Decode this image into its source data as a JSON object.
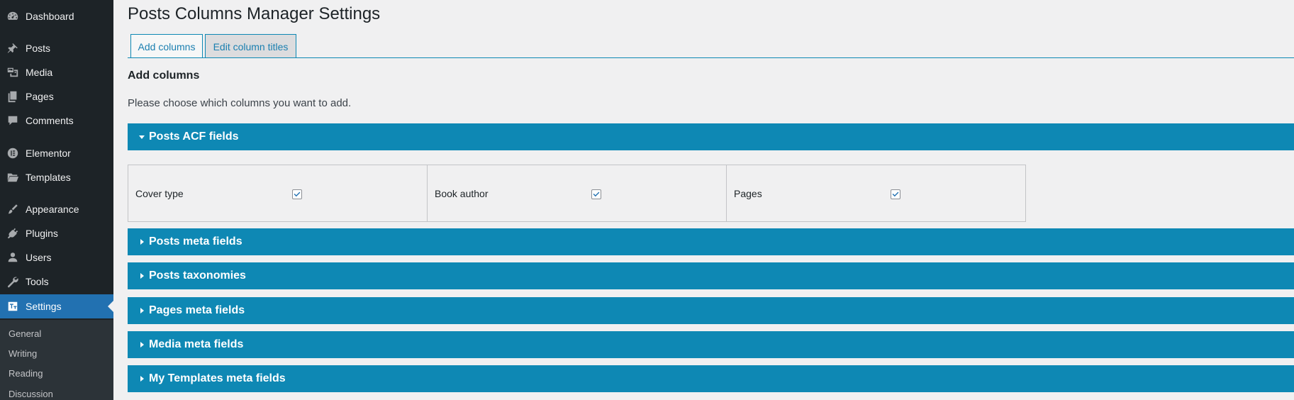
{
  "sidebar": {
    "items": [
      {
        "label": "Dashboard",
        "icon": "dashboard-icon"
      },
      {
        "label": "Posts",
        "icon": "pin-icon"
      },
      {
        "label": "Media",
        "icon": "media-icon"
      },
      {
        "label": "Pages",
        "icon": "pages-icon"
      },
      {
        "label": "Comments",
        "icon": "comment-icon"
      },
      {
        "label": "Elementor",
        "icon": "elementor-icon"
      },
      {
        "label": "Templates",
        "icon": "folder-icon"
      },
      {
        "label": "Appearance",
        "icon": "brush-icon"
      },
      {
        "label": "Plugins",
        "icon": "plug-icon"
      },
      {
        "label": "Users",
        "icon": "user-icon"
      },
      {
        "label": "Tools",
        "icon": "wrench-icon"
      },
      {
        "label": "Settings",
        "icon": "settings-icon",
        "active": true
      }
    ],
    "submenu": [
      "General",
      "Writing",
      "Reading",
      "Discussion"
    ]
  },
  "main": {
    "title": "Posts Columns Manager Settings",
    "tabs": [
      {
        "label": "Add columns",
        "active": true
      },
      {
        "label": "Edit column titles",
        "active": false
      }
    ],
    "section_heading": "Add columns",
    "description": "Please choose which columns you want to add.",
    "accordions": [
      {
        "label": "Posts ACF fields",
        "expanded": true
      },
      {
        "label": "Posts meta fields",
        "expanded": false
      },
      {
        "label": "Posts taxonomies",
        "expanded": false
      },
      {
        "label": "Pages meta fields",
        "expanded": false
      },
      {
        "label": "Media meta fields",
        "expanded": false
      },
      {
        "label": "My Templates meta fields",
        "expanded": false
      }
    ],
    "acf_fields": [
      {
        "label": "Cover type",
        "checked": true
      },
      {
        "label": "Book author",
        "checked": true
      },
      {
        "label": "Pages",
        "checked": true
      }
    ]
  },
  "colors": {
    "sidebar_bg": "#1d2327",
    "active_menu": "#2271b1",
    "accordion_bg": "#0e88b4",
    "page_bg": "#f0f0f1"
  }
}
